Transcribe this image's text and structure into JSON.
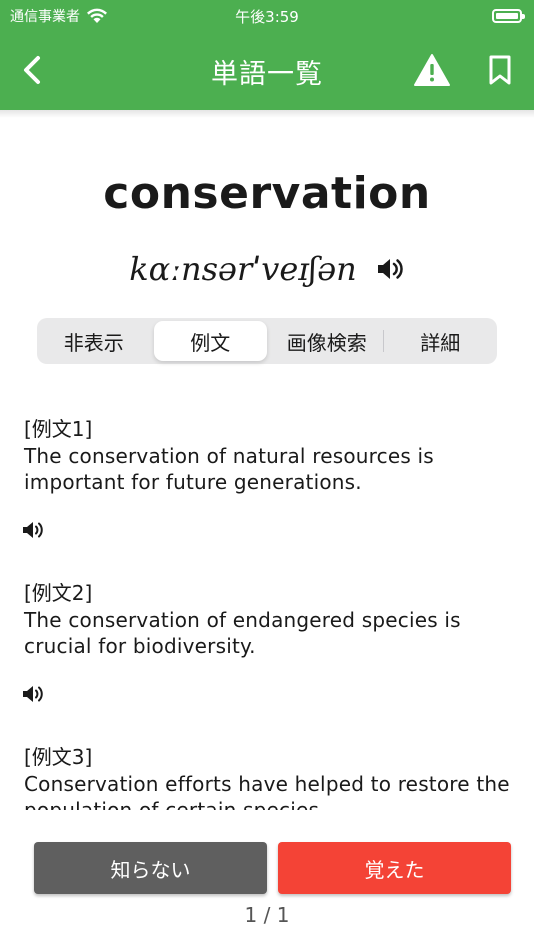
{
  "status_bar": {
    "carrier": "通信事業者",
    "time": "午後3:59"
  },
  "nav": {
    "title": "単語一覧"
  },
  "word": {
    "term": "conservation",
    "pronunciation": "kɑːnsərˈveɪʃən"
  },
  "tabs": [
    {
      "label": "非表示",
      "active": false
    },
    {
      "label": "例文",
      "active": true
    },
    {
      "label": "画像検索",
      "active": false
    },
    {
      "label": "詳細",
      "active": false
    }
  ],
  "examples": [
    {
      "label": "[例文1]",
      "line1": "The conservation of natural resources is",
      "line2": "important for future generations."
    },
    {
      "label": "[例文2]",
      "line1": "The conservation of endangered species is",
      "line2": "crucial for biodiversity."
    },
    {
      "label": "[例文3]",
      "line1": "Conservation efforts have helped to restore the",
      "line2": "population of certain species."
    }
  ],
  "buttons": {
    "unknown": "知らない",
    "known": "覚えた"
  },
  "pagination": "1 / 1",
  "colors": {
    "header": "#4caf50",
    "known_button": "#f44336",
    "unknown_button": "#5f5f5f"
  }
}
